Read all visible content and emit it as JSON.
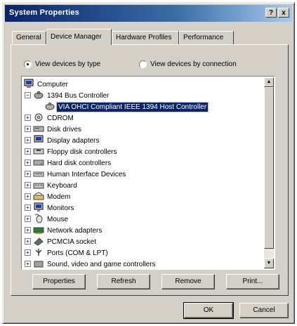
{
  "window": {
    "title": "System Properties",
    "help_glyph": "?",
    "close_glyph": "x"
  },
  "tabs": [
    {
      "label": "General",
      "active": false
    },
    {
      "label": "Device Manager",
      "active": true
    },
    {
      "label": "Hardware Profiles",
      "active": false
    },
    {
      "label": "Performance",
      "active": false
    }
  ],
  "view_options": {
    "by_type": {
      "label": "View devices by type",
      "checked": true
    },
    "by_connection": {
      "label": "View devices by connection",
      "checked": false
    }
  },
  "tree": {
    "root": {
      "label": "Computer",
      "icon": "computer-icon"
    },
    "items": [
      {
        "label": "1394 Bus Controller",
        "icon": "bus-controller-icon",
        "expanded": true
      },
      {
        "label": "VIA OHCI Compliant IEEE 1394 Host Controller",
        "icon": "device-icon",
        "child": true,
        "selected": true
      },
      {
        "label": "CDROM",
        "icon": "cdrom-icon"
      },
      {
        "label": "Disk drives",
        "icon": "disk-drive-icon"
      },
      {
        "label": "Display adapters",
        "icon": "display-adapter-icon"
      },
      {
        "label": "Floppy disk controllers",
        "icon": "floppy-controller-icon"
      },
      {
        "label": "Hard disk controllers",
        "icon": "hard-disk-controller-icon"
      },
      {
        "label": "Human Interface Devices",
        "icon": "hid-icon"
      },
      {
        "label": "Keyboard",
        "icon": "keyboard-icon"
      },
      {
        "label": "Modem",
        "icon": "modem-icon"
      },
      {
        "label": "Monitors",
        "icon": "monitor-icon"
      },
      {
        "label": "Mouse",
        "icon": "mouse-icon"
      },
      {
        "label": "Network adapters",
        "icon": "network-adapter-icon"
      },
      {
        "label": "PCMCIA socket",
        "icon": "pcmcia-icon"
      },
      {
        "label": "Ports (COM & LPT)",
        "icon": "ports-icon"
      },
      {
        "label": "Sound, video and game controllers",
        "icon": "sound-icon"
      }
    ]
  },
  "actions": {
    "properties": "Properties",
    "refresh": "Refresh",
    "remove": "Remove",
    "print": "Print..."
  },
  "dialog": {
    "ok": "OK",
    "cancel": "Cancel"
  }
}
